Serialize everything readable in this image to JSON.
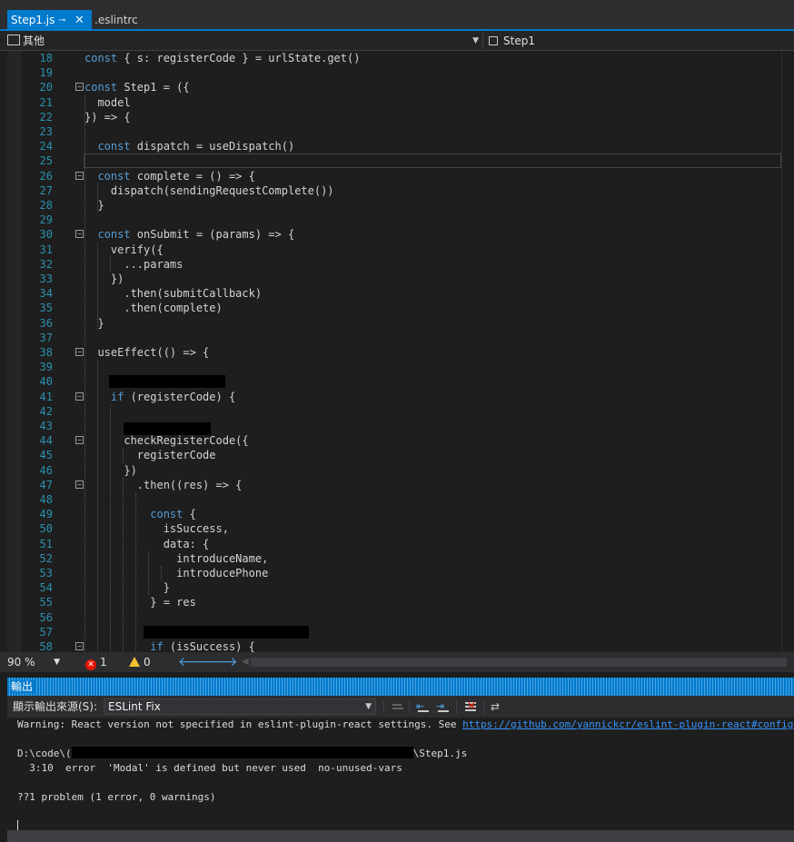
{
  "tabs": [
    {
      "label": "Step1.js",
      "active": true
    },
    {
      "label": ".eslintrc",
      "active": false
    }
  ],
  "navbar": {
    "left_label": "其他",
    "right_label": "Step1"
  },
  "editor": {
    "lines": [
      {
        "n": "18",
        "text": "const { s: registerCode } = urlState.get()"
      },
      {
        "n": "19",
        "text": ""
      },
      {
        "n": "20",
        "text": "const Step1 = ({"
      },
      {
        "n": "21",
        "text": "  model"
      },
      {
        "n": "22",
        "text": "}) => {"
      },
      {
        "n": "23",
        "text": ""
      },
      {
        "n": "24",
        "text": "  const dispatch = useDispatch()"
      },
      {
        "n": "25",
        "text": ""
      },
      {
        "n": "26",
        "text": "  const complete = () => {"
      },
      {
        "n": "27",
        "text": "    dispatch(sendingRequestComplete())"
      },
      {
        "n": "28",
        "text": "  }"
      },
      {
        "n": "29",
        "text": ""
      },
      {
        "n": "30",
        "text": "  const onSubmit = (params) => {"
      },
      {
        "n": "31",
        "text": "    verify({"
      },
      {
        "n": "32",
        "text": "      ...params"
      },
      {
        "n": "33",
        "text": "    })"
      },
      {
        "n": "34",
        "text": "      .then(submitCallback)"
      },
      {
        "n": "35",
        "text": "      .then(complete)"
      },
      {
        "n": "36",
        "text": "  }"
      },
      {
        "n": "37",
        "text": ""
      },
      {
        "n": "38",
        "text": "  useEffect(() => {"
      },
      {
        "n": "39",
        "text": ""
      },
      {
        "n": "40",
        "text": ""
      },
      {
        "n": "41",
        "text": "    if (registerCode) {"
      },
      {
        "n": "42",
        "text": ""
      },
      {
        "n": "43",
        "text": ""
      },
      {
        "n": "44",
        "text": "      checkRegisterCode({"
      },
      {
        "n": "45",
        "text": "        registerCode"
      },
      {
        "n": "46",
        "text": "      })"
      },
      {
        "n": "47",
        "text": "        .then((res) => {"
      },
      {
        "n": "48",
        "text": ""
      },
      {
        "n": "49",
        "text": "          const {"
      },
      {
        "n": "50",
        "text": "            isSuccess,"
      },
      {
        "n": "51",
        "text": "            data: {"
      },
      {
        "n": "52",
        "text": "              introduceName,"
      },
      {
        "n": "53",
        "text": "              introducePhone"
      },
      {
        "n": "54",
        "text": "            }"
      },
      {
        "n": "55",
        "text": "          } = res"
      },
      {
        "n": "56",
        "text": ""
      },
      {
        "n": "57",
        "text": ""
      },
      {
        "n": "58",
        "text": "          if (isSuccess) {"
      }
    ]
  },
  "status": {
    "zoom": "90 %",
    "errors": "1",
    "warnings": "0"
  },
  "output_panel": {
    "title": "輸出",
    "source_label": "顯示輸出來源(S):",
    "source_value": "ESLint Fix",
    "lines": [
      {
        "text": "Warning: React version not specified in eslint-plugin-react settings. See ",
        "link": "https://github.com/yannickcr/eslint-plugin-react#configuration",
        "after": "."
      },
      {
        "text": ""
      },
      {
        "text": "D:\\code\\(",
        "link": "",
        "after": "\\Step1.js"
      },
      {
        "text": "  3:10  error  'Modal' is defined but never used  no-unused-vars"
      },
      {
        "text": ""
      },
      {
        "text": "??1 problem (1 error, 0 warnings)"
      }
    ]
  }
}
